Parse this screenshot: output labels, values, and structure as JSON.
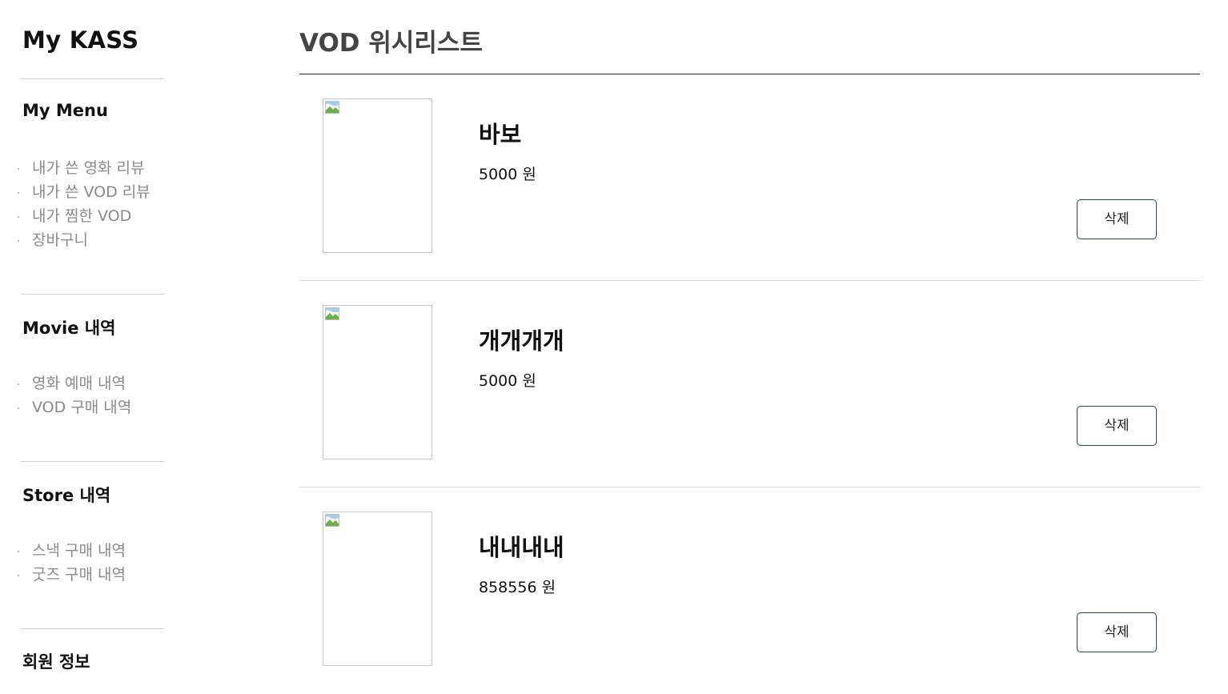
{
  "sidebar": {
    "brand": "My KASS",
    "sections": [
      {
        "title": "My Menu",
        "items": [
          "내가 쓴 영화 리뷰",
          "내가 쓴 VOD 리뷰",
          "내가 찜한 VOD",
          "장바구니"
        ]
      },
      {
        "title": "Movie 내역",
        "items": [
          "영화 예매 내역",
          "VOD 구매 내역"
        ]
      },
      {
        "title": "Store 내역",
        "items": [
          "스낵 구매 내역",
          "굿즈 구매 내역"
        ]
      },
      {
        "title": "회원 정보",
        "items": []
      }
    ]
  },
  "main": {
    "title": "VOD 위시리스트",
    "items": [
      {
        "name": "바보",
        "price": "5000 원",
        "delete_label": "삭제"
      },
      {
        "name": "개개개개",
        "price": "5000 원",
        "delete_label": "삭제"
      },
      {
        "name": "내내내내",
        "price": "858556 원",
        "delete_label": "삭제"
      }
    ]
  },
  "icons": {
    "thumbnail": "broken-image-icon"
  }
}
